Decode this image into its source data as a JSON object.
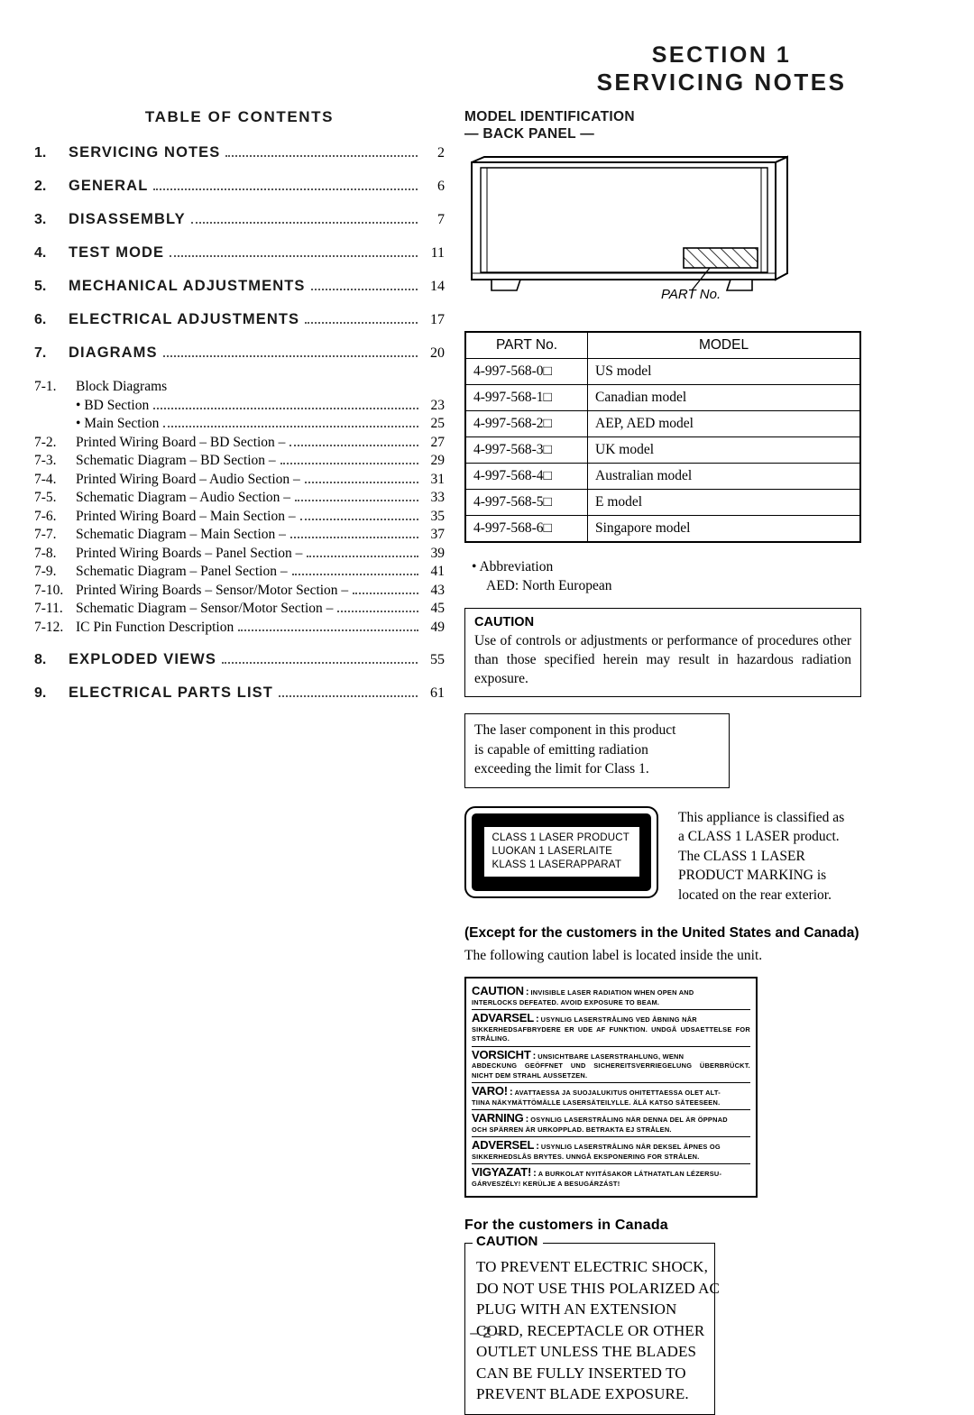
{
  "header": {
    "section_line": "SECTION   1",
    "title_line": "SERVICING  NOTES"
  },
  "toc": {
    "title": "TABLE  OF  CONTENTS",
    "main_entries": [
      {
        "num": "1.",
        "label": "SERVICING  NOTES",
        "page": "2"
      },
      {
        "num": "2.",
        "label": "GENERAL",
        "page": "6"
      },
      {
        "num": "3.",
        "label": "DISASSEMBLY",
        "page": "7"
      },
      {
        "num": "4.",
        "label": "TEST  MODE",
        "page": "11"
      },
      {
        "num": "5.",
        "label": "MECHANICAL  ADJUSTMENTS",
        "page": "14"
      },
      {
        "num": "6.",
        "label": "ELECTRICAL  ADJUSTMENTS",
        "page": "17"
      },
      {
        "num": "7.",
        "label": "DIAGRAMS",
        "page": "20"
      }
    ],
    "sub_entries": [
      {
        "num": "7-1.",
        "label": "Block Diagrams",
        "page": "",
        "dots": false,
        "bullet": false
      },
      {
        "num": "",
        "label": "• BD Section",
        "page": "23",
        "dots": true,
        "bullet": false
      },
      {
        "num": "",
        "label": "• Main Section",
        "page": "25",
        "dots": true,
        "bullet": false
      },
      {
        "num": "7-2.",
        "label": "Printed Wiring Board  – BD Section –",
        "page": "27",
        "dots": true,
        "bullet": false
      },
      {
        "num": "7-3.",
        "label": "Schematic Diagram – BD Section –",
        "page": "29",
        "dots": true,
        "bullet": false
      },
      {
        "num": "7-4.",
        "label": "Printed Wiring Board  – Audio Section –",
        "page": "31",
        "dots": true,
        "bullet": false
      },
      {
        "num": "7-5.",
        "label": "Schematic Diagram  – Audio Section –",
        "page": "33",
        "dots": true,
        "bullet": false
      },
      {
        "num": "7-6.",
        "label": "Printed Wiring Board  – Main Section –",
        "page": "35",
        "dots": true,
        "bullet": false
      },
      {
        "num": "7-7.",
        "label": "Schematic Diagram  – Main Section –",
        "page": "37",
        "dots": true,
        "bullet": false
      },
      {
        "num": "7-8.",
        "label": "Printed Wiring Boards  – Panel Section –",
        "page": "39",
        "dots": true,
        "bullet": false
      },
      {
        "num": "7-9.",
        "label": "Schematic Diagram  – Panel Section –",
        "page": "41",
        "dots": true,
        "bullet": false
      },
      {
        "num": "7-10.",
        "label": "Printed Wiring Boards  – Sensor/Motor Section –",
        "page": "43",
        "dots": true,
        "bullet": false
      },
      {
        "num": "7-11.",
        "label": "Schematic Diagram  – Sensor/Motor Section –",
        "page": "45",
        "dots": true,
        "bullet": false
      },
      {
        "num": "7-12.",
        "label": "IC Pin Function Description",
        "page": "49",
        "dots": true,
        "bullet": false
      }
    ],
    "tail_entries": [
      {
        "num": "8.",
        "label": "EXPLODED  VIEWS",
        "page": "55"
      },
      {
        "num": "9.",
        "label": "ELECTRICAL  PARTS  LIST",
        "page": "61"
      }
    ]
  },
  "model_id": {
    "heading_line1": "MODEL IDENTIFICATION",
    "heading_line2": "— BACK PANEL —",
    "part_no_caption": "PART No.",
    "table": {
      "headers": [
        "PART No.",
        "MODEL"
      ],
      "rows": [
        {
          "part": "4-997-568-0□",
          "model": "US model"
        },
        {
          "part": "4-997-568-1□",
          "model": "Canadian model"
        },
        {
          "part": "4-997-568-2□",
          "model": "AEP, AED model"
        },
        {
          "part": "4-997-568-3□",
          "model": "UK model"
        },
        {
          "part": "4-997-568-4□",
          "model": "Australian model"
        },
        {
          "part": "4-997-568-5□",
          "model": "E model"
        },
        {
          "part": "4-997-568-6□",
          "model": "Singapore model"
        }
      ]
    },
    "abbrev_line1": "• Abbreviation",
    "abbrev_line2": "AED:  North European"
  },
  "caution_box": {
    "title": "CAUTION",
    "body": "Use of controls or adjustments or performance of procedures other than those specified herein may result in hazardous radiation exposure."
  },
  "laser_box": {
    "line1": "The laser component in this product",
    "line2": "is capable of emitting radiation",
    "line3": "exceeding the limit for Class 1."
  },
  "class1": {
    "label_lines": [
      "CLASS 1 LASER PRODUCT",
      "LUOKAN 1 LASERLAITE",
      "KLASS 1 LASERAPPARAT"
    ],
    "text_lines": [
      "This appliance is classified as",
      "a CLASS 1 LASER product.",
      "The CLASS 1 LASER",
      "PRODUCT MARKING is",
      "located on the rear exterior."
    ]
  },
  "except_section": {
    "heading": "(Except for the customers in the United States and Canada)",
    "body": "The following caution label is located inside the unit."
  },
  "warning_label": {
    "blocks": [
      {
        "keyword": "CAUTION",
        "colon": ":",
        "first_line": "INVISIBLE  LASER  RADIATION  WHEN  OPEN  AND",
        "rest": "INTERLOCKS  DEFEATED.   AVOID  EXPOSURE  TO  BEAM."
      },
      {
        "keyword": "ADVARSEL",
        "colon": ":",
        "first_line": "USYNLIG  LASERSTRÅLING  VED  ÅBNING  NÅR",
        "rest": "SIKKERHEDSAFBRYDERE  ER  UDE  AF  FUNKTION.  UNDGÅ  UDSAETTELSE FOR  STRÅLING."
      },
      {
        "keyword": "VORSICHT",
        "colon": ":",
        "first_line": "UNSICHTBARE  LASERSTRAHLUNG,  WENN",
        "rest": "ABDECKUNG  GEÖFFNET  UND  SICHEREITSVERRIEGELUNG ÜBERBRÜCKT.  NICHT  DEM  STRAHL  AUSSETZEN."
      },
      {
        "keyword": "VARO!",
        "colon": ":",
        "first_line": "AVATTAESSA JA SUOJALUKITUS OHITETTAESSA OLET ALT-",
        "rest": "TIINA  NÄKYMÄTTÖMÄLLE  LASERSÄTEILYLLE.  ÄLÄ  KATSO  SÄTEESEEN."
      },
      {
        "keyword": "VARNING",
        "colon": ":",
        "first_line": "OSYNLIG LASERSTRÅLING NÄR DENNA DEL ÄR ÖPPNAD",
        "rest": "OCH SPÄRREN ÄR URKOPPLAD. BETRAKTA EJ STRÅLEN."
      },
      {
        "keyword": "ADVERSEL",
        "colon": ":",
        "first_line": "USYNLIG LASERSTRÅLING NÅR DEKSEL ÅPNES OG",
        "rest": "SIKKERHEDSLÅS BRYTES.  UNNGÅ EKSPONERING FOR STRÅLEN."
      },
      {
        "keyword": "VIGYAZAT!",
        "colon": ":",
        "first_line": "A  BURKOLAT  NYITÁSAKOR  LÁTHATATLAN  LÉZERSU-",
        "rest": "GÁRVESZÉLY!  KERÜLJE  A  BESUGÁRZÁST!"
      }
    ]
  },
  "canada": {
    "heading": "For the customers in Canada",
    "legend": "CAUTION",
    "lines": [
      "TO PREVENT ELECTRIC SHOCK,",
      "DO NOT USE THIS POLARIZED AC",
      "PLUG WITH AN EXTENSION",
      "CORD, RECEPTACLE OR OTHER",
      "OUTLET UNLESS THE BLADES",
      "CAN BE FULLY INSERTED TO",
      "PREVENT BLADE EXPOSURE."
    ]
  },
  "footer": {
    "page_number": "– 2 –"
  }
}
